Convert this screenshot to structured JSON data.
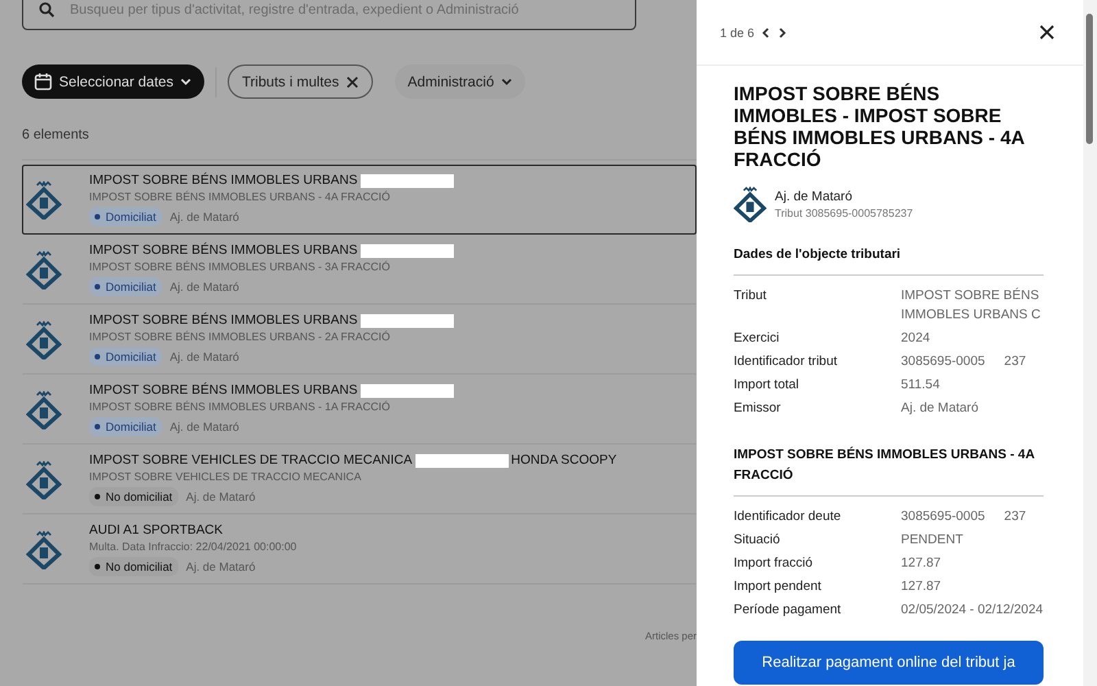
{
  "search": {
    "placeholder": "Busqueu per tipus d'activitat, registre d'entrada, expedient o Administració"
  },
  "filters": [
    {
      "kind": "dates",
      "label": "Seleccionar dates"
    },
    {
      "kind": "chip",
      "label": "Tributs i multes"
    },
    {
      "kind": "dropdown",
      "label": "Administració"
    }
  ],
  "count": "6 elements",
  "items": [
    {
      "title": "IMPOST SOBRE BÉNS IMMOBLES URBANS",
      "redacted": true,
      "subtitle": "IMPOST SOBRE BÉNS IMMOBLES URBANS - 4A FRACCIÓ",
      "status": "Domiciliat",
      "domiciled": true,
      "issuer": "Aj. de Mataró",
      "selected": true
    },
    {
      "title": "IMPOST SOBRE BÉNS IMMOBLES URBANS",
      "redacted": true,
      "subtitle": "IMPOST SOBRE BÉNS IMMOBLES URBANS - 3A FRACCIÓ",
      "status": "Domiciliat",
      "domiciled": true,
      "issuer": "Aj. de Mataró",
      "selected": false
    },
    {
      "title": "IMPOST SOBRE BÉNS IMMOBLES URBANS",
      "redacted": true,
      "subtitle": "IMPOST SOBRE BÉNS IMMOBLES URBANS - 2A FRACCIÓ",
      "status": "Domiciliat",
      "domiciled": true,
      "issuer": "Aj. de Mataró",
      "selected": false
    },
    {
      "title": "IMPOST SOBRE BÉNS IMMOBLES URBANS",
      "redacted": true,
      "subtitle": "IMPOST SOBRE BÉNS IMMOBLES URBANS - 1A FRACCIÓ",
      "status": "Domiciliat",
      "domiciled": true,
      "issuer": "Aj. de Mataró",
      "selected": false
    },
    {
      "title": "IMPOST SOBRE VEHICLES DE TRACCIO MECANICA",
      "redacted": true,
      "title_end": "HONDA SCOOPY",
      "subtitle": "IMPOST SOBRE VEHICLES DE TRACCIO MECANICA",
      "status": "No domiciliat",
      "domiciled": false,
      "issuer": "Aj. de Mataró",
      "selected": false
    },
    {
      "title": "AUDI A1 SPORTBACK",
      "redacted": false,
      "subtitle": "Multa. Data Infraccio: 22/04/2021 00:00:00",
      "status": "No domiciliat",
      "domiciled": false,
      "issuer": "Aj. de Mataró",
      "selected": false
    }
  ],
  "footer": "Articles per",
  "panel": {
    "pager": "1 de 6",
    "title": "IMPOST SOBRE BÉNS IMMOBLES - IMPOST SOBRE BÉNS IMMOBLES URBANS - 4A FRACCIÓ",
    "issuer": "Aj. de Mataró",
    "tribut": "Tribut 3085695-0005785237",
    "sections": [
      {
        "heading": "Dades de l'objecte tributari",
        "rows": [
          {
            "label": "Tribut",
            "value": "IMPOST SOBRE BÉNS IMMOBLES URBANS C"
          },
          {
            "label": "Exercici",
            "value": "2024"
          },
          {
            "label": "Identificador tribut",
            "value": "3085695-0005",
            "value_end": "237"
          },
          {
            "label": "Import total",
            "value": "511.54"
          },
          {
            "label": "Emissor",
            "value": "Aj. de Mataró"
          }
        ]
      },
      {
        "heading": "IMPOST SOBRE BÉNS IMMOBLES URBANS - 4A FRACCIÓ",
        "rows": [
          {
            "label": "Identificador deute",
            "value": "3085695-0005",
            "value_end": "237"
          },
          {
            "label": "Situació",
            "value": "PENDENT"
          },
          {
            "label": "Import fracció",
            "value": "127.87"
          },
          {
            "label": "Import pendent",
            "value": "127.87"
          },
          {
            "label": "Període pagament",
            "value": "02/05/2024 - 02/12/2024"
          }
        ]
      }
    ],
    "button": "Realitzar pagament online del tribut ja"
  }
}
